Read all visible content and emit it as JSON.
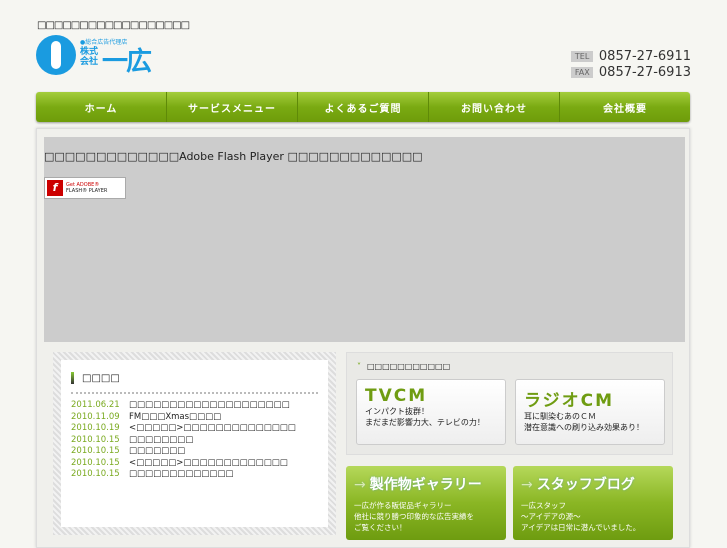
{
  "header": {
    "tagline": "□□□□□□□□□□□□□□□□□□",
    "logo": {
      "small": "●総合広告代理店",
      "kabushiki": "株式会社",
      "name": "一広"
    },
    "tel_label": "TEL",
    "tel": "0857-27-6911",
    "fax_label": "FAX",
    "fax": "0857-27-6913"
  },
  "nav": [
    "ホーム",
    "サービスメニュー",
    "よくあるご質問",
    "お問い合わせ",
    "会社概要"
  ],
  "flash": {
    "message": "□□□□□□□□□□□□□Adobe Flash Player □□□□□□□□□□□□□",
    "badge_get": "Get ADOBE®",
    "badge_name": "FLASH® PLAYER"
  },
  "news": {
    "title": "□□□□",
    "items": [
      {
        "date": "2011.06.21",
        "text": "□□□□□□□□□□□□□□□□□□□□"
      },
      {
        "date": "2010.11.09",
        "text": "FM□□□Xmas□□□□"
      },
      {
        "date": "2010.10.19",
        "text": "<□□□□□>□□□□□□□□□□□□□□"
      },
      {
        "date": "2010.10.15",
        "text": "□□□□□□□□"
      },
      {
        "date": "2010.10.15",
        "text": "□□□□□□□"
      },
      {
        "date": "2010.10.15",
        "text": "<□□□□□>□□□□□□□□□□□□□"
      },
      {
        "date": "2010.10.15",
        "text": "□□□□□□□□□□□□□"
      }
    ]
  },
  "services": {
    "title": "□□□□□□□□□□□",
    "tvcm": {
      "title": "TVCM",
      "line1": "インパクト抜群！",
      "line2": "まだまだ影響力大、テレビの力！"
    },
    "radiocm": {
      "title": "ラジオCM",
      "line1": "耳に馴染むあのＣＭ",
      "line2": "潜在意識への刷り込み効果あり！"
    }
  },
  "gallery": {
    "arrow": "→",
    "title": "製作物ギャラリー",
    "line1": "一広が作る販促品ギャラリー",
    "line2": "他社に競り勝つ印象的な広告実績を",
    "line3": "ご覧ください！"
  },
  "blog": {
    "arrow": "→",
    "title": "スタッフブログ",
    "line1": "一広スタッフ",
    "line2": "～アイデアの源～",
    "line3": "アイデアは日常に潜んでいました。"
  }
}
